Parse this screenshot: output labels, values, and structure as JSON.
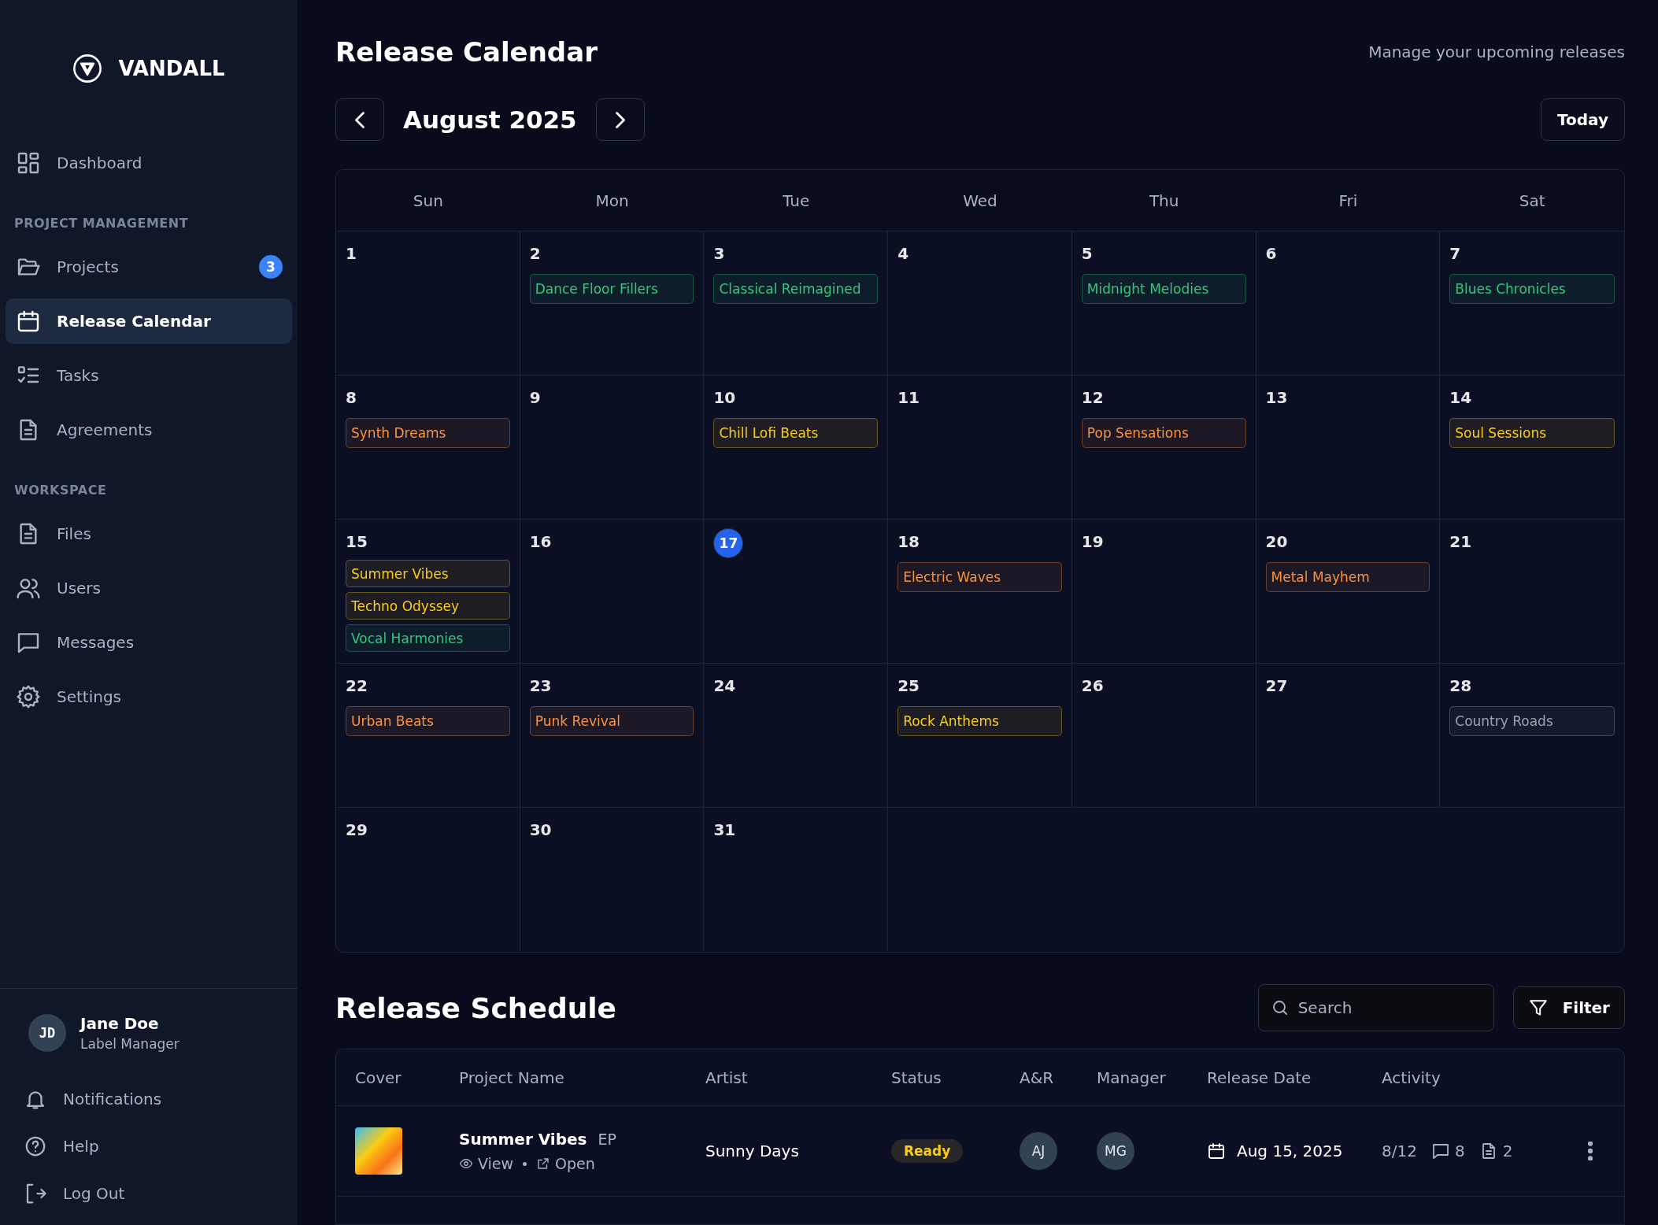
{
  "sidebar": {
    "brand": "VANDALL",
    "sections": [
      {
        "items": [
          {
            "label": "Dashboard",
            "selected": false
          }
        ]
      },
      {
        "heading": "PROJECT MANAGEMENT",
        "items": [
          {
            "label": "Projects",
            "badge": "3",
            "selected": false
          },
          {
            "label": "Release Calendar",
            "selected": true
          },
          {
            "label": "Tasks",
            "selected": false
          },
          {
            "label": "Agreements",
            "selected": false
          }
        ]
      },
      {
        "heading": "WORKSPACE",
        "items": [
          {
            "label": "Files",
            "selected": false
          },
          {
            "label": "Users",
            "selected": false
          },
          {
            "label": "Messages",
            "selected": false
          },
          {
            "label": "Settings",
            "selected": false
          }
        ]
      }
    ],
    "user": {
      "initials": "JD",
      "name": "Jane Doe",
      "role": "Label Manager"
    },
    "footer_items": [
      {
        "label": "Notifications"
      },
      {
        "label": "Help"
      },
      {
        "label": "Log Out"
      }
    ]
  },
  "header": {
    "title": "Release Calendar",
    "subtitle": "Manage your upcoming releases"
  },
  "calendar": {
    "month": "August 2025",
    "today_button": "Today",
    "weekdays": [
      "Sun",
      "Mon",
      "Tue",
      "Wed",
      "Thu",
      "Fri",
      "Sat"
    ],
    "days": [
      {
        "day": "1",
        "today": false
      },
      {
        "day": "2",
        "today": false,
        "events": [
          {
            "title": "Dance Floor Fillers",
            "color": "#34c77b"
          }
        ]
      },
      {
        "day": "3",
        "today": false,
        "events": [
          {
            "title": "Classical Reimagined",
            "color": "#34c77b"
          }
        ]
      },
      {
        "day": "4",
        "today": false
      },
      {
        "day": "5",
        "today": false,
        "events": [
          {
            "title": "Midnight Melodies",
            "color": "#34c77b"
          }
        ]
      },
      {
        "day": "6",
        "today": false
      },
      {
        "day": "7",
        "today": false,
        "events": [
          {
            "title": "Blues Chronicles",
            "color": "#34c77b"
          }
        ]
      },
      {
        "day": "8",
        "today": false,
        "events": [
          {
            "title": "Synth Dreams",
            "color": "#fb923c"
          }
        ]
      },
      {
        "day": "9",
        "today": false
      },
      {
        "day": "10",
        "today": false,
        "events": [
          {
            "title": "Chill Lofi Beats",
            "color": "#facc15"
          }
        ]
      },
      {
        "day": "11",
        "today": false
      },
      {
        "day": "12",
        "today": false,
        "events": [
          {
            "title": "Pop Sensations",
            "color": "#fb923c"
          }
        ]
      },
      {
        "day": "13",
        "today": false
      },
      {
        "day": "14",
        "today": false,
        "events": [
          {
            "title": "Soul Sessions",
            "color": "#facc15"
          }
        ]
      },
      {
        "day": "15",
        "today": false,
        "events": [
          {
            "title": "Summer Vibes",
            "color": "#facc15"
          },
          {
            "title": "Techno Odyssey",
            "color": "#facc15"
          },
          {
            "title": "Vocal Harmonies",
            "color": "#34c77b"
          }
        ]
      },
      {
        "day": "16",
        "today": false
      },
      {
        "day": "17",
        "today": true
      },
      {
        "day": "18",
        "today": false,
        "events": [
          {
            "title": "Electric Waves",
            "color": "#fb923c"
          }
        ]
      },
      {
        "day": "19",
        "today": false
      },
      {
        "day": "20",
        "today": false,
        "events": [
          {
            "title": "Metal Mayhem",
            "color": "#fb923c"
          }
        ]
      },
      {
        "day": "21",
        "today": false
      },
      {
        "day": "22",
        "today": false,
        "events": [
          {
            "title": "Urban Beats",
            "color": "#fb923c"
          }
        ]
      },
      {
        "day": "23",
        "today": false,
        "events": [
          {
            "title": "Punk Revival",
            "color": "#fb923c"
          }
        ]
      },
      {
        "day": "24",
        "today": false
      },
      {
        "day": "25",
        "today": false,
        "events": [
          {
            "title": "Rock Anthems",
            "color": "#facc15"
          }
        ]
      },
      {
        "day": "26",
        "today": false
      },
      {
        "day": "27",
        "today": false
      },
      {
        "day": "28",
        "today": false,
        "events": [
          {
            "title": "Country Roads",
            "color": "#9ca3af"
          }
        ]
      },
      {
        "day": "29",
        "today": false
      },
      {
        "day": "30",
        "today": false
      },
      {
        "day": "31",
        "today": false
      }
    ]
  },
  "schedule": {
    "title": "Release Schedule",
    "search": {
      "placeholder": "Search"
    },
    "filter_button": "Filter",
    "columns": [
      "Cover",
      "Project Name",
      "Artist",
      "Status",
      "A&R",
      "Manager",
      "Release Date",
      "Activity"
    ],
    "rows": [
      {
        "project_name": "Summer Vibes",
        "type": "EP",
        "view": "View",
        "open": "Open",
        "artist": "Sunny Days",
        "status": "Ready",
        "ar": "AJ",
        "manager": "MG",
        "release_date": "Aug 15, 2025",
        "tasks": "8/12",
        "comments": "8",
        "files": "2"
      }
    ]
  }
}
